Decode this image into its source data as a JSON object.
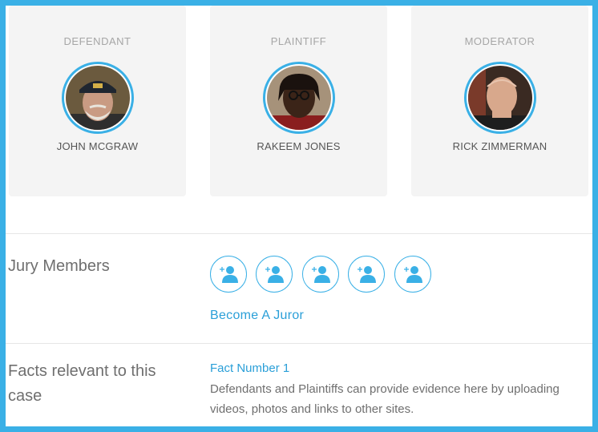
{
  "participants": [
    {
      "role": "DEFENDANT",
      "name": "JOHN MCGRAW",
      "avatar": "photo-older-man-cap"
    },
    {
      "role": "PLAINTIFF",
      "name": "RAKEEM JONES",
      "avatar": "photo-man-glasses"
    },
    {
      "role": "MODERATOR",
      "name": "RICK ZIMMERMAN",
      "avatar": "photo-bald-man"
    }
  ],
  "jury": {
    "title": "Jury Members",
    "slots": [
      {
        "icon": "add-user-icon"
      },
      {
        "icon": "add-user-icon"
      },
      {
        "icon": "add-user-icon"
      },
      {
        "icon": "add-user-icon"
      },
      {
        "icon": "add-user-icon"
      }
    ],
    "become_label": "Become A Juror"
  },
  "facts": {
    "title_line1": "Facts relevant to this",
    "title_line2": "case",
    "items": [
      {
        "title": "Fact Number 1",
        "description": "Defendants and Plaintiffs can provide evidence here by uploading videos, photos and links to other sites."
      }
    ]
  },
  "colors": {
    "accent": "#3ab0e6",
    "link": "#2a9fd8",
    "card_bg": "#f4f4f4"
  }
}
